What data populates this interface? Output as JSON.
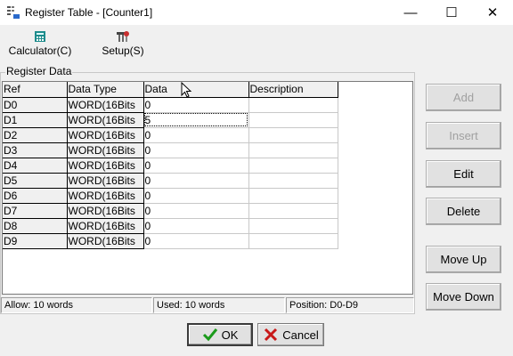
{
  "window": {
    "title": "Register Table - [Counter1]",
    "minimize_glyph": "—",
    "maximize_glyph": "☐",
    "close_glyph": "✕"
  },
  "toolbar": {
    "calculator_label": "Calculator(C)",
    "setup_label": "Setup(S)"
  },
  "group": {
    "label": "Register Data"
  },
  "table": {
    "columns": [
      "Ref",
      "Data Type",
      "Data",
      "Description"
    ],
    "rows": [
      {
        "ref": "D0",
        "type": "WORD(16Bits",
        "data": "0",
        "desc": ""
      },
      {
        "ref": "D1",
        "type": "WORD(16Bits",
        "data": "5",
        "desc": ""
      },
      {
        "ref": "D2",
        "type": "WORD(16Bits",
        "data": "0",
        "desc": ""
      },
      {
        "ref": "D3",
        "type": "WORD(16Bits",
        "data": "0",
        "desc": ""
      },
      {
        "ref": "D4",
        "type": "WORD(16Bits",
        "data": "0",
        "desc": ""
      },
      {
        "ref": "D5",
        "type": "WORD(16Bits",
        "data": "0",
        "desc": ""
      },
      {
        "ref": "D6",
        "type": "WORD(16Bits",
        "data": "0",
        "desc": ""
      },
      {
        "ref": "D7",
        "type": "WORD(16Bits",
        "data": "0",
        "desc": ""
      },
      {
        "ref": "D8",
        "type": "WORD(16Bits",
        "data": "0",
        "desc": ""
      },
      {
        "ref": "D9",
        "type": "WORD(16Bits",
        "data": "0",
        "desc": ""
      }
    ]
  },
  "status": {
    "allow": "Allow: 10 words",
    "used": "Used: 10 words",
    "position": "Position: D0-D9"
  },
  "buttons": {
    "add": "Add",
    "insert": "Insert",
    "edit": "Edit",
    "delete": "Delete",
    "move_up": "Move Up",
    "move_down": "Move Down",
    "ok": "OK",
    "cancel": "Cancel"
  },
  "icons": {
    "app": "register-table-icon",
    "calculator": "calculator-icon",
    "setup": "setup-icon",
    "ok": "checkmark-icon",
    "cancel": "x-mark-icon"
  },
  "colors": {
    "ok_check": "#1a9a1a",
    "cancel_x": "#c81818",
    "disabled_text": "#a0a0a0"
  }
}
